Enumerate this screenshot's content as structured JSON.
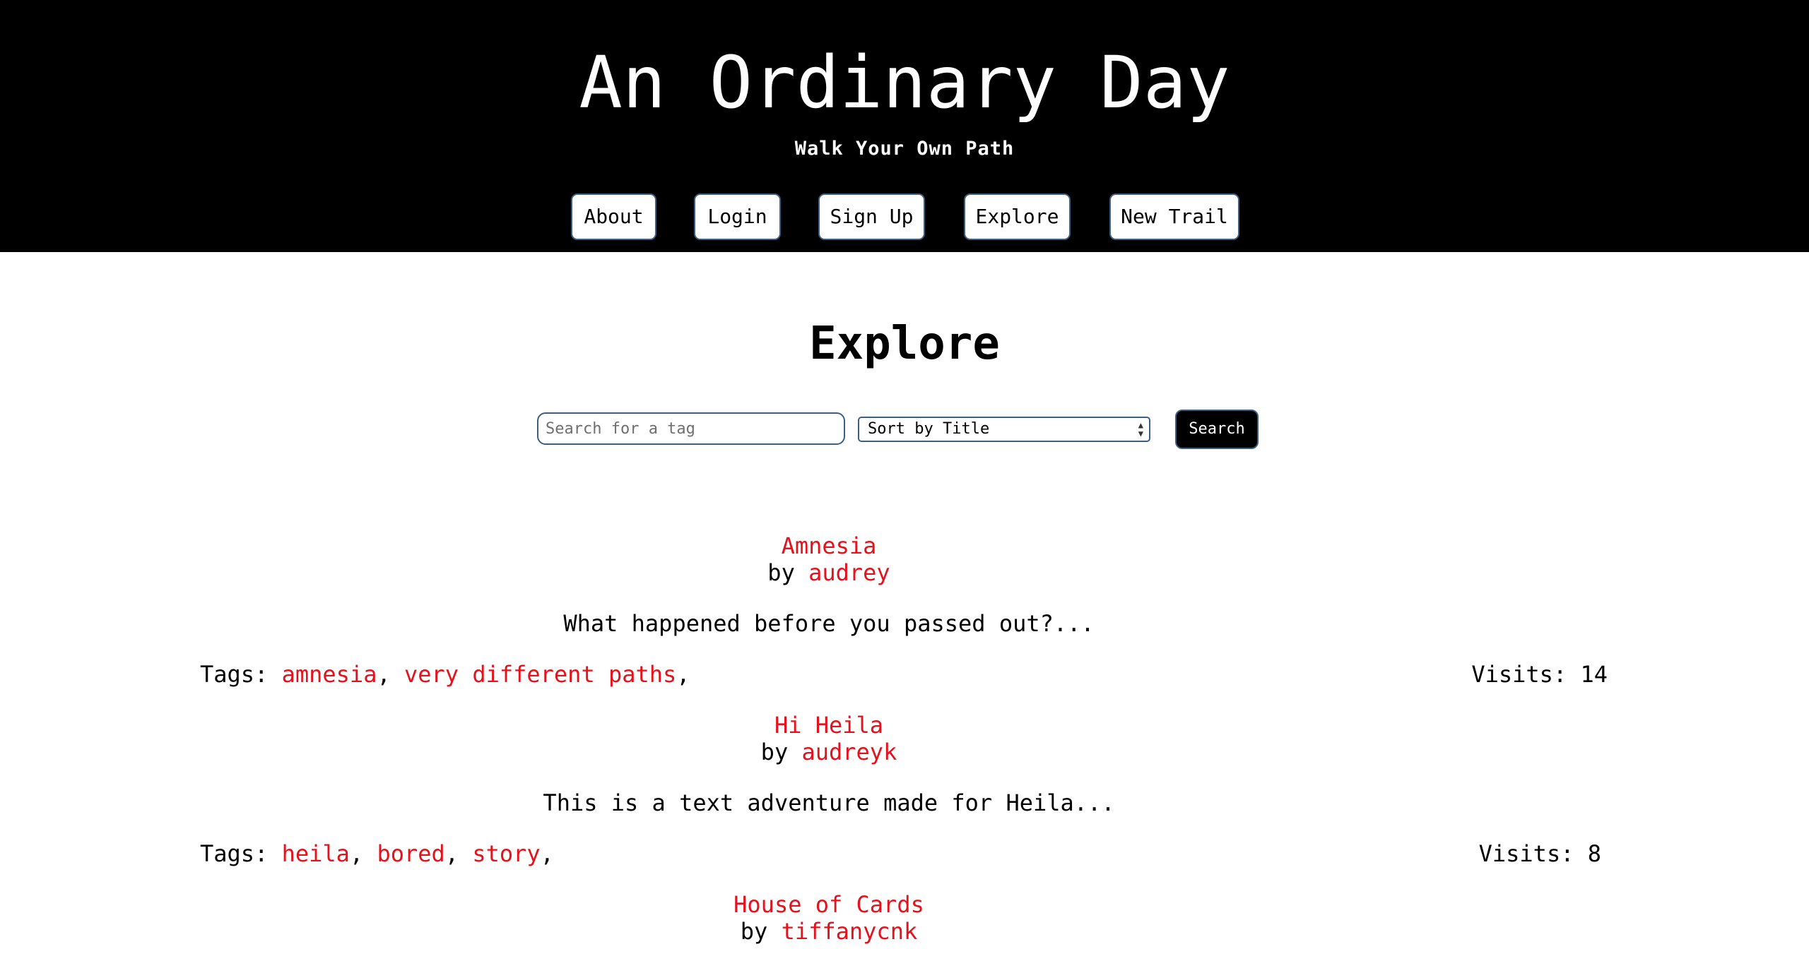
{
  "site": {
    "title": "An Ordinary Day",
    "tagline": "Walk Your Own Path"
  },
  "nav": {
    "about": "About",
    "login": "Login",
    "signup": "Sign Up",
    "explore": "Explore",
    "new_trail": "New Trail"
  },
  "page": {
    "title": "Explore"
  },
  "search": {
    "placeholder": "Search for a tag",
    "sort_selected": "Sort by Title",
    "button": "Search"
  },
  "labels": {
    "by": "by",
    "tags": "Tags:",
    "visits": "Visits:",
    "separator": ","
  },
  "trails": [
    {
      "title": "Amnesia",
      "author": "audrey",
      "description": "What happened before you passed out?...",
      "tags": [
        "amnesia",
        "very different paths"
      ],
      "visits": "14"
    },
    {
      "title": "Hi Heila",
      "author": "audreyk",
      "description": "This is a text adventure made for Heila...",
      "tags": [
        "heila",
        "bored",
        "story"
      ],
      "visits": "8"
    },
    {
      "title": "House of Cards",
      "author": "tiffanycnk"
    }
  ],
  "colors": {
    "header_bg": "#000000",
    "link_red": "#e3121d",
    "button_border": "#3d5f82"
  }
}
